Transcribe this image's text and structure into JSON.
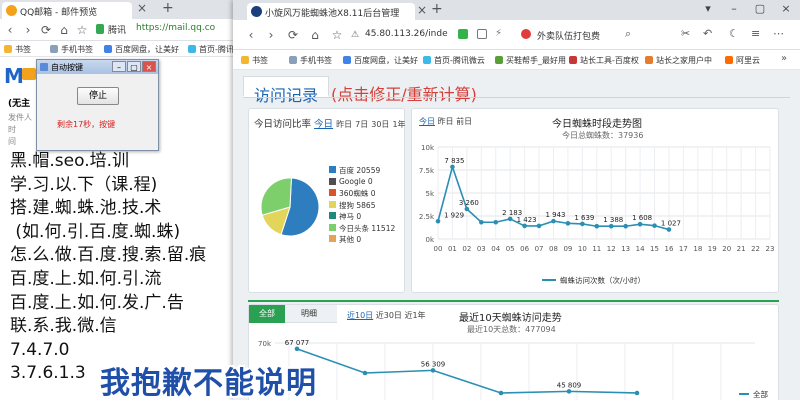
{
  "left_browser": {
    "tab_title": "QQ邮箱 - 邮件预览",
    "url_prefix": "腾讯",
    "url": "https://mail.qq.co",
    "bookmarks": [
      "书签",
      "手机书签",
      "百度网盘，让美好",
      "首页-腾讯微"
    ],
    "page_title": "(无主",
    "page_meta": [
      "发件人",
      "时",
      "间"
    ]
  },
  "dialog": {
    "title": "自动按键",
    "stop_label": "停止",
    "countdown": "剩余17秒，按键",
    "minimize": "–",
    "restore": "▢",
    "close": "×"
  },
  "right_browser": {
    "tab_title": "小旋风万能蜘蛛池X8.11后台管理",
    "url": "45.80.113.26/inde",
    "search_text": "外卖队伍打包费",
    "bookmarks": [
      "书签",
      "手机书签",
      "百度网盘，让美好",
      "首页-腾讯微云",
      "买鞋帮手_最好用",
      "站长工具-百度权",
      "站长之家用户中",
      "阿里云"
    ],
    "page_tabs": {
      "active": "访问记录",
      "link": "(点击修正/重新计算)"
    }
  },
  "visit_ratio": {
    "header_label": "今日访问比率",
    "today_link": "今日",
    "periods": [
      "昨日",
      "7日",
      "30日",
      "1年"
    ],
    "legend": [
      {
        "label": "百度 20559",
        "color": "#2e7dbf"
      },
      {
        "label": "Google 0",
        "color": "#4f4f4f"
      },
      {
        "label": "360蜘蛛 0",
        "color": "#d9532b"
      },
      {
        "label": "搜狗 5865",
        "color": "#e2d55a"
      },
      {
        "label": "神马 0",
        "color": "#1e8a7a"
      },
      {
        "label": "今日头条 11512",
        "color": "#7ccf6a"
      },
      {
        "label": "其他 0",
        "color": "#e6a357"
      }
    ],
    "pie": [
      {
        "name": "百度",
        "value": 20559,
        "color": "#2e7dbf"
      },
      {
        "name": "搜狗",
        "value": 5865,
        "color": "#e2d55a"
      },
      {
        "name": "今日头条",
        "value": 11512,
        "color": "#7ccf6a"
      }
    ]
  },
  "hourly": {
    "today_link": "今日",
    "periods": [
      "昨日",
      "前日"
    ],
    "title": "今日蜘蛛时段走势图",
    "subtitle": "今日总蜘蛛数：37936",
    "legend": "蜘蛛访问次数（次/小时）",
    "color": "#2b8fb3"
  },
  "chart_data": [
    {
      "type": "line",
      "title": "今日蜘蛛时段走势图",
      "subtitle": "今日总蜘蛛数：37936",
      "x": [
        "00",
        "01",
        "02",
        "03",
        "04",
        "05",
        "06",
        "07",
        "08",
        "09",
        "10",
        "11",
        "12",
        "13",
        "14",
        "15",
        "16",
        "17",
        "18",
        "19",
        "20",
        "21",
        "22",
        "23"
      ],
      "series": [
        {
          "name": "蜘蛛访问次数（次/小时）",
          "values": [
            1929,
            7835,
            3260,
            1820,
            1820,
            2183,
            1423,
            1423,
            1943,
            1700,
            1639,
            1388,
            1388,
            1388,
            1608,
            1450,
            1027
          ]
        }
      ],
      "data_labels": [
        "1 929",
        "7 835",
        "3 260",
        "2 183",
        "1 423",
        "1 943",
        "1 639",
        "1 388",
        "1 608",
        "1 027"
      ],
      "ylim": [
        0,
        10000
      ],
      "yticks": [
        "0k",
        "2.5k",
        "5k",
        "7.5k",
        "10k"
      ],
      "grid": true,
      "legend_position": "bottom"
    },
    {
      "type": "line",
      "title": "最近10天蜘蛛访问走势",
      "subtitle": "最近10天总数：477094",
      "series": [
        {
          "name": "全部",
          "values": [
            67077,
            55000,
            56309,
            45000,
            45809,
            45000
          ]
        }
      ],
      "data_labels": [
        "67 077",
        "56 309",
        "45 809"
      ],
      "ylim": [
        0,
        70000
      ],
      "yticks": [
        "70k"
      ],
      "grid": true,
      "legend_position": "right"
    }
  ],
  "recent10": {
    "tabs": [
      "全部",
      "明细"
    ],
    "days_link": "近10日",
    "periods": [
      "近30日",
      "近1年"
    ],
    "title": "最近10天蜘蛛访问走势",
    "subtitle": "最近10天总数：477094",
    "legend": "全部",
    "color": "#2b8fb3"
  },
  "watermark_lines": [
    "黑.帽.seo.培.训",
    "学.习.以.下（课.程)",
    "搭.建.蜘.蛛.池.技.术",
    " (如.何.引.百.度.蜘.蛛)",
    "怎.么.做.百.度.搜.索.留.痕",
    "百.度.上.如.何.引.流",
    "百.度.上.如.何.发.广.告",
    "联.系.我.微.信",
    "7.4.7.0",
    "3.7.6.1.3"
  ],
  "apology": "我抱歉不能说明"
}
